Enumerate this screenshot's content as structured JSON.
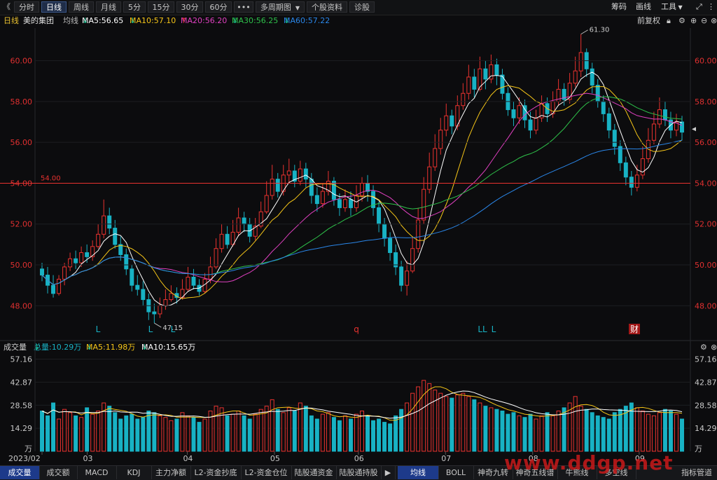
{
  "toolbar": {
    "collapse_icon": "double-left-chevron-icon",
    "periods": [
      "分时",
      "日线",
      "周线",
      "月线",
      "5分",
      "15分",
      "30分",
      "60分"
    ],
    "active_period": "日线",
    "more": "•••",
    "multi_period": "多周期图",
    "stock_info": "个股资料",
    "diagnose": "诊股",
    "chips": "筹码",
    "draw": "画线",
    "tools": "工具"
  },
  "info": {
    "period": "日线",
    "name": "美的集团",
    "ma_label": "均线",
    "ma5": "MA5:56.65",
    "ma10": "MA10:57.10",
    "ma20": "MA20:56.20",
    "ma30": "MA30:56.25",
    "ma60": "MA60:57.22",
    "adjust": "前复权"
  },
  "volume_info": {
    "label": "成交量",
    "total": "总量:10.29万",
    "ma5": "MA5:11.98万",
    "ma10": "MA10:15.65万"
  },
  "colors": {
    "up": "#e8322f",
    "down": "#18b2c4",
    "ma5": "#ffffff",
    "ma10": "#f5c518",
    "ma20": "#e040c0",
    "ma30": "#2ec24a",
    "ma60": "#2a86e8",
    "axis_text": "#e03030"
  },
  "chart_data": {
    "type": "candlestick",
    "price_ticks": [
      "60.00",
      "58.00",
      "56.00",
      "54.00",
      "52.00",
      "50.00",
      "48.00"
    ],
    "ylim": [
      46.5,
      61.6
    ],
    "hline": {
      "value": 54.0,
      "label": "54.00"
    },
    "high_label": "61.30",
    "low_label": "47.15",
    "x_labels": [
      "2023/02",
      "03",
      "04",
      "05",
      "06",
      "07",
      "08",
      "09"
    ],
    "volume_ticks": [
      "57.16",
      "42.87",
      "28.58",
      "14.29",
      "万"
    ],
    "volume_ylim": [
      0,
      60
    ],
    "markers": [
      "L",
      "L",
      "L",
      "q",
      "LL",
      "L",
      "财"
    ],
    "candles": [
      [
        49.8,
        49.5,
        50.1,
        49.2
      ],
      [
        49.5,
        49.0,
        49.9,
        48.6
      ],
      [
        49.0,
        48.6,
        49.5,
        48.4
      ],
      [
        48.6,
        49.3,
        49.5,
        48.5
      ],
      [
        49.3,
        49.9,
        50.1,
        49.0
      ],
      [
        49.9,
        50.3,
        50.6,
        49.7
      ],
      [
        50.3,
        50.1,
        50.7,
        49.8
      ],
      [
        50.1,
        50.6,
        50.9,
        49.9
      ],
      [
        50.6,
        50.4,
        51.0,
        50.1
      ],
      [
        50.4,
        50.9,
        51.2,
        50.2
      ],
      [
        50.9,
        51.5,
        52.0,
        50.8
      ],
      [
        51.5,
        52.4,
        53.2,
        51.3
      ],
      [
        52.4,
        51.8,
        52.8,
        51.5
      ],
      [
        51.8,
        51.0,
        52.2,
        50.8
      ],
      [
        51.0,
        50.5,
        51.4,
        50.2
      ],
      [
        50.5,
        49.8,
        50.8,
        49.5
      ],
      [
        49.8,
        49.0,
        50.0,
        48.7
      ],
      [
        49.0,
        48.8,
        49.5,
        48.5
      ],
      [
        48.8,
        48.3,
        49.2,
        48.0
      ],
      [
        48.3,
        47.7,
        48.6,
        47.3
      ],
      [
        47.7,
        47.6,
        48.1,
        47.15
      ],
      [
        47.6,
        48.0,
        48.4,
        47.4
      ],
      [
        48.0,
        48.3,
        48.8,
        47.8
      ],
      [
        48.3,
        48.6,
        49.0,
        48.2
      ],
      [
        48.6,
        48.4,
        48.9,
        48.1
      ],
      [
        48.4,
        48.8,
        49.3,
        48.3
      ],
      [
        48.8,
        49.4,
        49.9,
        48.7
      ],
      [
        49.4,
        49.0,
        49.8,
        48.8
      ],
      [
        49.0,
        48.7,
        49.3,
        48.5
      ],
      [
        48.7,
        49.3,
        49.6,
        48.6
      ],
      [
        49.3,
        49.9,
        50.4,
        49.1
      ],
      [
        49.9,
        50.8,
        51.3,
        49.8
      ],
      [
        50.8,
        51.5,
        52.0,
        50.6
      ],
      [
        51.5,
        51.0,
        51.9,
        50.8
      ],
      [
        51.0,
        51.6,
        52.2,
        50.9
      ],
      [
        51.6,
        52.3,
        52.8,
        51.4
      ],
      [
        52.3,
        52.0,
        52.6,
        51.6
      ],
      [
        52.0,
        51.4,
        52.3,
        51.1
      ],
      [
        51.4,
        51.9,
        52.3,
        51.2
      ],
      [
        51.9,
        52.6,
        53.1,
        51.8
      ],
      [
        52.6,
        53.4,
        54.1,
        52.5
      ],
      [
        53.4,
        54.2,
        54.9,
        53.2
      ],
      [
        54.2,
        53.6,
        54.5,
        53.3
      ],
      [
        53.6,
        54.4,
        54.9,
        53.4
      ],
      [
        54.4,
        54.6,
        55.2,
        54.0
      ],
      [
        54.6,
        54.1,
        54.9,
        53.8
      ],
      [
        54.1,
        54.7,
        55.1,
        53.9
      ],
      [
        54.7,
        54.2,
        55.0,
        53.8
      ],
      [
        54.2,
        53.4,
        54.5,
        53.0
      ],
      [
        53.4,
        53.0,
        53.8,
        52.6
      ],
      [
        53.0,
        53.6,
        54.0,
        52.8
      ],
      [
        53.6,
        54.1,
        54.6,
        53.4
      ],
      [
        54.1,
        53.2,
        54.3,
        52.9
      ],
      [
        53.2,
        52.8,
        53.5,
        52.4
      ],
      [
        52.8,
        53.2,
        53.7,
        52.6
      ],
      [
        53.2,
        52.8,
        53.6,
        52.4
      ],
      [
        52.8,
        53.4,
        53.9,
        52.6
      ],
      [
        53.4,
        54.0,
        54.3,
        53.1
      ],
      [
        54.0,
        53.6,
        54.4,
        53.1
      ],
      [
        53.6,
        52.8,
        53.9,
        52.4
      ],
      [
        52.8,
        52.0,
        53.1,
        51.6
      ],
      [
        52.0,
        51.3,
        52.3,
        50.9
      ],
      [
        51.3,
        50.6,
        51.6,
        50.2
      ],
      [
        50.6,
        49.9,
        51.0,
        49.5
      ],
      [
        49.9,
        49.0,
        50.2,
        48.7
      ],
      [
        49.0,
        49.7,
        50.2,
        48.5
      ],
      [
        49.7,
        50.8,
        51.4,
        49.6
      ],
      [
        50.8,
        52.2,
        52.8,
        50.6
      ],
      [
        52.2,
        53.7,
        54.3,
        52.0
      ],
      [
        53.7,
        54.8,
        55.5,
        53.5
      ],
      [
        54.8,
        55.7,
        56.4,
        54.6
      ],
      [
        55.7,
        56.6,
        57.2,
        55.4
      ],
      [
        56.6,
        57.3,
        57.9,
        56.3
      ],
      [
        57.3,
        56.8,
        57.6,
        56.4
      ],
      [
        56.8,
        57.8,
        58.3,
        56.6
      ],
      [
        57.8,
        58.4,
        58.9,
        57.6
      ],
      [
        58.4,
        59.2,
        59.8,
        58.1
      ],
      [
        59.2,
        58.6,
        59.6,
        58.2
      ],
      [
        58.6,
        59.6,
        60.2,
        58.5
      ],
      [
        59.6,
        59.1,
        60.0,
        58.6
      ],
      [
        59.1,
        59.8,
        60.3,
        58.9
      ],
      [
        59.8,
        59.3,
        60.1,
        58.8
      ],
      [
        59.3,
        58.4,
        59.6,
        58.1
      ],
      [
        58.4,
        57.6,
        58.7,
        57.3
      ],
      [
        57.6,
        57.2,
        58.0,
        56.8
      ],
      [
        57.2,
        57.8,
        58.2,
        56.9
      ],
      [
        57.8,
        57.1,
        58.1,
        56.7
      ],
      [
        57.1,
        56.6,
        57.5,
        56.2
      ],
      [
        56.6,
        57.2,
        57.6,
        56.4
      ],
      [
        57.2,
        57.9,
        58.3,
        57.0
      ],
      [
        57.9,
        57.4,
        58.2,
        57.0
      ],
      [
        57.4,
        58.0,
        58.5,
        57.2
      ],
      [
        58.0,
        58.6,
        59.1,
        57.8
      ],
      [
        58.6,
        58.1,
        58.9,
        57.8
      ],
      [
        58.1,
        58.9,
        59.4,
        57.9
      ],
      [
        58.9,
        59.5,
        60.2,
        58.7
      ],
      [
        59.5,
        60.4,
        61.3,
        59.2
      ],
      [
        60.4,
        59.6,
        60.6,
        59.2
      ],
      [
        59.6,
        58.8,
        59.9,
        58.4
      ],
      [
        58.8,
        58.0,
        59.1,
        57.7
      ],
      [
        58.0,
        57.4,
        58.3,
        57.0
      ],
      [
        57.4,
        56.6,
        57.7,
        56.2
      ],
      [
        56.6,
        55.8,
        56.9,
        55.4
      ],
      [
        55.8,
        55.0,
        56.1,
        54.6
      ],
      [
        55.0,
        54.3,
        55.3,
        53.9
      ],
      [
        54.3,
        53.8,
        54.6,
        53.4
      ],
      [
        53.8,
        54.4,
        54.9,
        53.6
      ],
      [
        54.4,
        55.2,
        55.8,
        54.2
      ],
      [
        55.2,
        56.1,
        56.7,
        55.0
      ],
      [
        56.1,
        56.9,
        57.5,
        55.9
      ],
      [
        56.9,
        57.6,
        58.2,
        56.7
      ],
      [
        57.6,
        57.1,
        58.0,
        56.8
      ],
      [
        57.1,
        56.6,
        57.5,
        56.2
      ],
      [
        56.6,
        57.0,
        57.4,
        56.3
      ],
      [
        57.0,
        56.5,
        57.3,
        56.1
      ]
    ],
    "volumes": [
      25,
      22,
      30,
      20,
      26,
      24,
      22,
      21,
      27,
      23,
      25,
      30,
      28,
      24,
      20,
      22,
      23,
      20,
      21,
      25,
      24,
      22,
      21,
      19,
      20,
      24,
      22,
      21,
      18,
      20,
      25,
      28,
      27,
      22,
      23,
      25,
      22,
      20,
      23,
      26,
      28,
      32,
      26,
      24,
      27,
      25,
      30,
      28,
      22,
      20,
      23,
      24,
      21,
      19,
      22,
      20,
      23,
      25,
      22,
      19,
      20,
      18,
      17,
      22,
      26,
      30,
      36,
      40,
      44,
      42,
      38,
      36,
      34,
      33,
      35,
      36,
      34,
      32,
      30,
      28,
      27,
      26,
      25,
      23,
      24,
      22,
      21,
      23,
      20,
      22,
      24,
      22,
      25,
      27,
      30,
      34,
      28,
      26,
      24,
      22,
      21,
      20,
      24,
      26,
      28,
      30,
      27,
      25,
      23,
      22,
      24,
      26,
      25,
      23,
      20,
      18
    ]
  }
}
